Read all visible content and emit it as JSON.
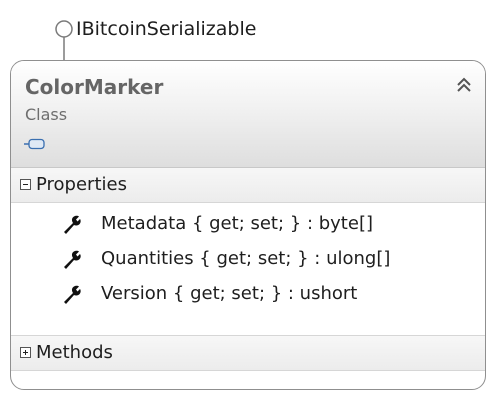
{
  "interface": {
    "name": "IBitcoinSerializable",
    "icon": "interface-lollipop-icon"
  },
  "class_shape": {
    "name": "ColorMarker",
    "kind": "Class",
    "collapse_icon": "double-chevron-up-icon",
    "compartments": [
      {
        "label": "Properties",
        "expanded": true,
        "members": [
          {
            "text": "Metadata { get; set; } : byte[]",
            "icon": "wrench-icon"
          },
          {
            "text": "Quantities { get; set; } : ulong[]",
            "icon": "wrench-icon"
          },
          {
            "text": "Version { get; set; } : ushort",
            "icon": "wrench-icon"
          }
        ]
      },
      {
        "label": "Methods",
        "expanded": false,
        "members": []
      }
    ]
  },
  "colors": {
    "border": "#8f8f8f",
    "header_text": "#656565",
    "header_gradient_bottom": "#dedede"
  }
}
